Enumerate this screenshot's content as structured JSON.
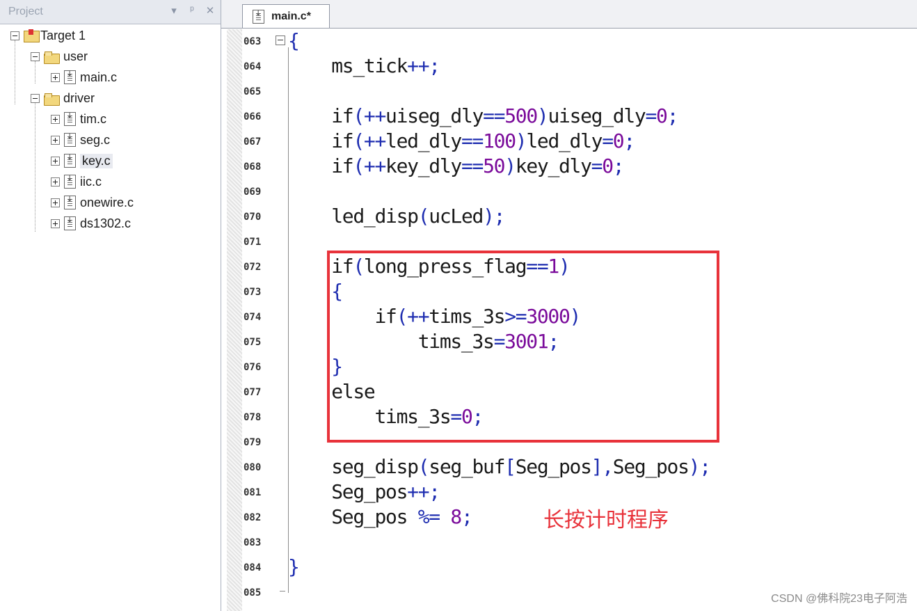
{
  "project": {
    "title": "Project",
    "controls": [
      "▾",
      "ᵖ",
      "✕"
    ],
    "tree": [
      {
        "label": "Target 1",
        "type": "target",
        "level": 0
      },
      {
        "label": "user",
        "type": "folder",
        "level": 1
      },
      {
        "label": "main.c",
        "type": "file",
        "level": 2
      },
      {
        "label": "driver",
        "type": "folder",
        "level": 1
      },
      {
        "label": "tim.c",
        "type": "file",
        "level": 2
      },
      {
        "label": "seg.c",
        "type": "file",
        "level": 2
      },
      {
        "label": "key.c",
        "type": "file",
        "level": 2,
        "selected": true
      },
      {
        "label": "iic.c",
        "type": "file",
        "level": 2
      },
      {
        "label": "onewire.c",
        "type": "file",
        "level": 2
      },
      {
        "label": "ds1302.c",
        "type": "file",
        "level": 2
      }
    ]
  },
  "editor": {
    "tab_label": "main.c*",
    "lines": [
      {
        "no": "063",
        "code": "{"
      },
      {
        "no": "064",
        "code": "    ms_tick++;"
      },
      {
        "no": "065",
        "code": ""
      },
      {
        "no": "066",
        "code": "    if(++uiseg_dly==500)uiseg_dly=0;"
      },
      {
        "no": "067",
        "code": "    if(++led_dly==100)led_dly=0;"
      },
      {
        "no": "068",
        "code": "    if(++key_dly==50)key_dly=0;"
      },
      {
        "no": "069",
        "code": ""
      },
      {
        "no": "070",
        "code": "    led_disp(ucLed);"
      },
      {
        "no": "071",
        "code": ""
      },
      {
        "no": "072",
        "code": "    if(long_press_flag==1)"
      },
      {
        "no": "073",
        "code": "    {"
      },
      {
        "no": "074",
        "code": "        if(++tims_3s>=3000)"
      },
      {
        "no": "075",
        "code": "            tims_3s=3001;"
      },
      {
        "no": "076",
        "code": "    }"
      },
      {
        "no": "077",
        "code": "    else"
      },
      {
        "no": "078",
        "code": "        tims_3s=0;"
      },
      {
        "no": "079",
        "code": ""
      },
      {
        "no": "080",
        "code": "    seg_disp(seg_buf[Seg_pos],Seg_pos);"
      },
      {
        "no": "081",
        "code": "    Seg_pos++;"
      },
      {
        "no": "082",
        "code": "    Seg_pos %= 8;"
      },
      {
        "no": "083",
        "code": ""
      },
      {
        "no": "084",
        "code": "}"
      },
      {
        "no": "085",
        "code": ""
      }
    ],
    "annotation": "长按计时程序"
  },
  "watermark": "CSDN @佛科院23电子阿浩"
}
